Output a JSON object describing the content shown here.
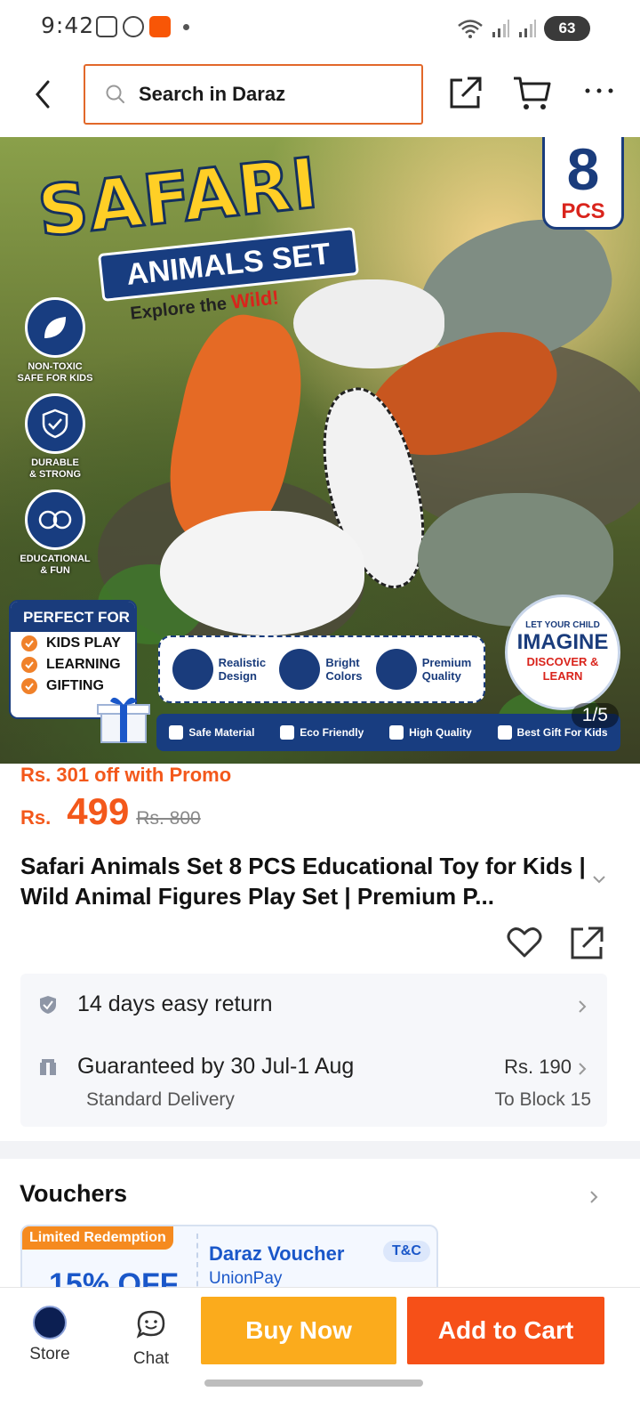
{
  "status_bar": {
    "time": "9:42",
    "battery": "63"
  },
  "search": {
    "placeholder": "Search in Daraz"
  },
  "hero": {
    "title": "SAFARI",
    "subtitle": "ANIMALS SET",
    "tagline": "Explore the",
    "tagline_emph": "Wild!",
    "pcs_number": "8",
    "pcs_label": "PCS",
    "features": [
      {
        "line1": "NON-TOXIC",
        "line2": "SAFE FOR KIDS",
        "icon": "leaf-icon"
      },
      {
        "line1": "DURABLE",
        "line2": "& STRONG",
        "icon": "shield-check-icon"
      },
      {
        "line1": "EDUCATIONAL",
        "line2": "& FUN",
        "icon": "kids-icon"
      }
    ],
    "perfect_for": {
      "heading": "PERFECT FOR",
      "items": [
        "KIDS PLAY",
        "LEARNING",
        "GIFTING"
      ]
    },
    "qualities": [
      {
        "line1": "Realistic",
        "line2": "Design"
      },
      {
        "line1": "Bright",
        "line2": "Colors"
      },
      {
        "line1": "Premium",
        "line2": "Quality"
      }
    ],
    "imagine": {
      "top": "LET YOUR CHILD",
      "big": "IMAGINE",
      "line1": "DISCOVER &",
      "line2": "LEARN"
    },
    "strip": [
      "Safe Material",
      "Eco Friendly",
      "High Quality",
      "Best Gift For Kids"
    ],
    "page_counter": "1/5"
  },
  "price": {
    "promo": "Rs. 301 off with Promo",
    "currency": "Rs.",
    "current": "499",
    "original": "Rs. 800"
  },
  "product": {
    "title": "Safari Animals Set 8 PCS Educational Toy for Kids | Wild Animal Figures Play Set | Premium P..."
  },
  "services": {
    "return": "14 days easy return",
    "delivery": "Guaranteed by 30 Jul-1 Aug",
    "delivery_type": "Standard Delivery",
    "delivery_price": "Rs. 190",
    "destination": "To Block 15"
  },
  "vouchers": {
    "heading": "Vouchers",
    "card": {
      "badge": "Limited Redemption",
      "percent": "15% OFF",
      "name": "Daraz Voucher",
      "sub": "UnionPay",
      "tc": "T&C"
    }
  },
  "bottom_bar": {
    "store_label": "Store",
    "chat_label": "Chat",
    "buy_now": "Buy Now",
    "add_to_cart": "Add to Cart"
  },
  "colors": {
    "accent": "#f3581b",
    "buy_now": "#fbab1c",
    "add_to_cart": "#f65018",
    "voucher_blue": "#1a57c9"
  }
}
